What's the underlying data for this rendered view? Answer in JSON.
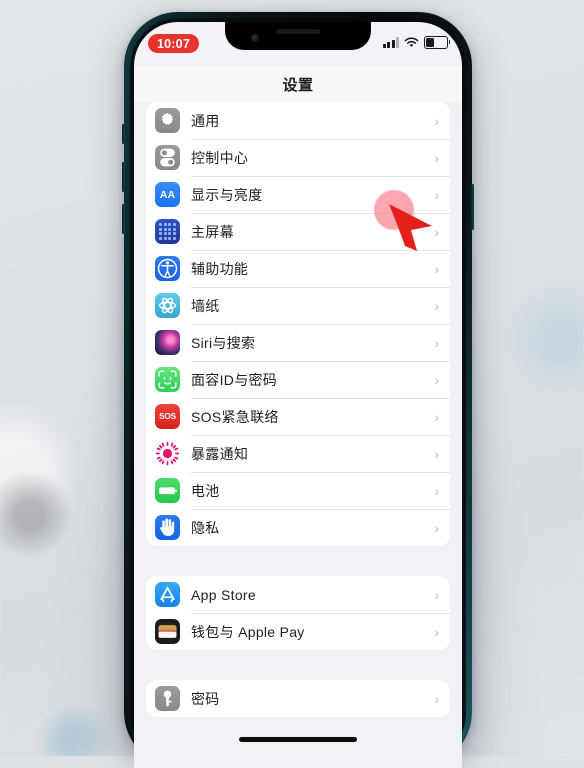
{
  "statusbar": {
    "time": "10:07",
    "time_badge_color": "#e7332b",
    "signal_icon": "cellular-bars-icon",
    "wifi_icon": "wifi-icon",
    "battery_icon": "battery-icon",
    "battery_level_percent": 36
  },
  "navbar": {
    "title": "设置"
  },
  "groups": [
    {
      "rows": [
        {
          "label": "通用",
          "icon": "gear-icon",
          "chevron": "›"
        },
        {
          "label": "控制中心",
          "icon": "control-center-icon",
          "chevron": "›"
        },
        {
          "label": "显示与亮度",
          "icon": "display-brightness-icon",
          "chevron": "›"
        },
        {
          "label": "主屏幕",
          "icon": "home-screen-icon",
          "chevron": "›"
        },
        {
          "label": "辅助功能",
          "icon": "accessibility-icon",
          "chevron": "›"
        },
        {
          "label": "墙纸",
          "icon": "wallpaper-icon",
          "chevron": "›"
        },
        {
          "label": "Siri与搜索",
          "icon": "siri-icon",
          "chevron": "›"
        },
        {
          "label": "面容ID与密码",
          "icon": "face-id-icon",
          "chevron": "›"
        },
        {
          "label": "SOS紧急联络",
          "icon": "sos-icon",
          "chevron": "›"
        },
        {
          "label": "暴露通知",
          "icon": "exposure-notification-icon",
          "chevron": "›"
        },
        {
          "label": "电池",
          "icon": "battery-settings-icon",
          "chevron": "›"
        },
        {
          "label": "隐私",
          "icon": "privacy-hand-icon",
          "chevron": "›"
        }
      ]
    },
    {
      "rows": [
        {
          "label": "App Store",
          "icon": "app-store-icon",
          "chevron": "›"
        },
        {
          "label": "钱包与 Apple Pay",
          "icon": "wallet-icon",
          "chevron": "›"
        }
      ]
    },
    {
      "rows": [
        {
          "label": "密码",
          "icon": "passwords-key-icon",
          "chevron": "›"
        }
      ]
    }
  ],
  "overlays": {
    "cursor": "red-arrow-cursor",
    "tap_highlight": "pink-tap-highlight",
    "touch_indicator": "gray-touch-indicator",
    "home_indicator": "home-indicator-bar"
  },
  "colors": {
    "screen_bg": "#f1f1f6",
    "card_bg": "#ffffff",
    "accent_blue": "#1a72f0",
    "accent_green": "#2fce57",
    "accent_red": "#d8221c",
    "bezel": "#0a1416",
    "bezel_edge_teal": "#1d5a63",
    "page_bg": "#dfe3e7"
  }
}
